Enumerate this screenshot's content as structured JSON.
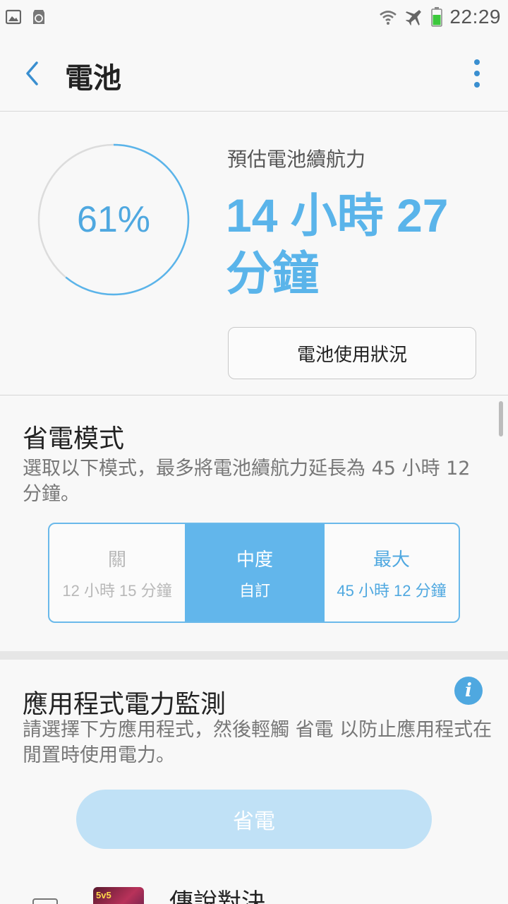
{
  "status_bar": {
    "time": "22:29",
    "left_icons": [
      "gallery-icon",
      "recycle-icon"
    ],
    "right_icons": [
      "wifi-icon",
      "airplane-mode-icon",
      "battery-icon"
    ]
  },
  "app_bar": {
    "title": "電池",
    "back_icon": "chevron-left-icon",
    "more_icon": "more-vert-icon"
  },
  "summary": {
    "battery_level_percent": 61,
    "battery_level_text": "61%",
    "estimate_label": "預估電池續航力",
    "estimate_value": "14 小時 27 分鐘",
    "usage_button": "電池使用狀況"
  },
  "power_saving": {
    "title": "省電模式",
    "description": "選取以下模式，最多將電池續航力延長為 45 小時 12 分鐘。",
    "options": [
      {
        "name": "關",
        "sub": "12 小時 15 分鐘"
      },
      {
        "name": "中度",
        "sub": "自訂"
      },
      {
        "name": "最大",
        "sub": "45 小時 12 分鐘"
      }
    ],
    "selected_index": 1
  },
  "app_power_monitor": {
    "title": "應用程式電力監測",
    "info_icon": "info-icon",
    "info_glyph": "i",
    "description": "請選擇下方應用程式，然後輕觸 省電 以防止應用程式在閒置時使用電力。",
    "save_button": "省電",
    "apps": [
      {
        "name": "傳說對決",
        "badge": "5v5",
        "checked": false
      }
    ]
  },
  "colors": {
    "accent": "#4fa8e0",
    "selected_segment": "#62b6eb",
    "disabled_button": "#c0e1f6"
  }
}
